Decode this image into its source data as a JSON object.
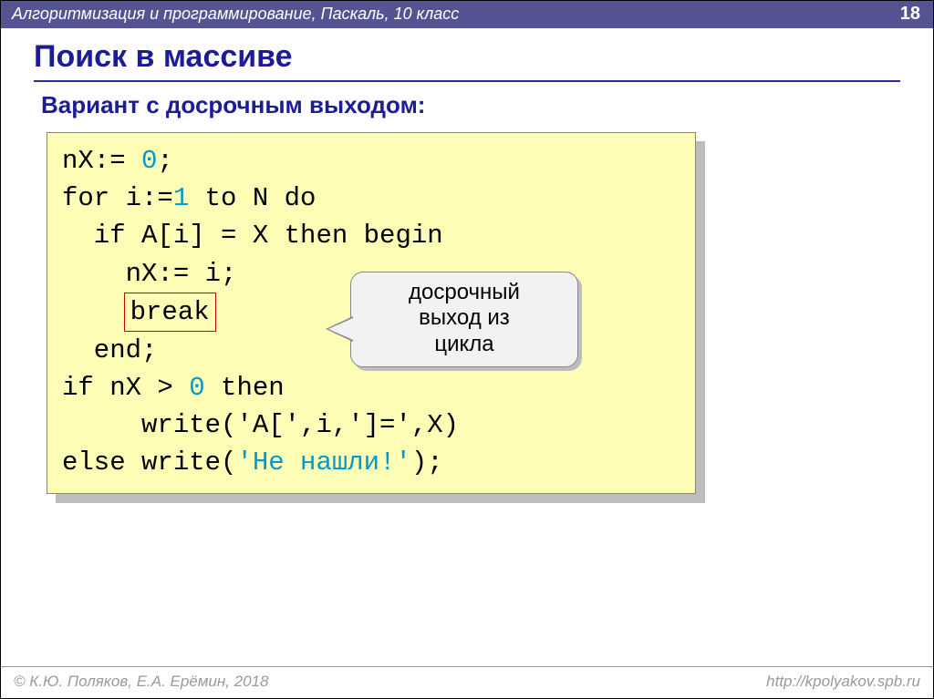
{
  "header": {
    "course": "Алгоритмизация и программирование, Паскаль, 10 класс",
    "page": "18"
  },
  "title": "Поиск в массиве",
  "subtitle": "Вариант с досрочным выходом:",
  "code": {
    "l1a": "nX:= ",
    "l1b": "0",
    "l1c": ";",
    "l2a": "for i:=",
    "l2b": "1",
    "l2c": " to N do",
    "l3": "  if A[i] = X then begin",
    "l4": "    nX:= i;",
    "l5_break": "break",
    "l6": "  end;",
    "l7a": "if nX > ",
    "l7b": "0",
    "l7c": " then",
    "l8": "     write('A[',i,']=',X)",
    "l9a": "else write(",
    "l9b": "'Не нашли!'",
    "l9c": ");"
  },
  "callout": {
    "line1": "досрочный",
    "line2": "выход из",
    "line3": "цикла"
  },
  "footer": {
    "left": "© К.Ю. Поляков, Е.А. Ерёмин, 2018",
    "right": "http://kpolyakov.spb.ru"
  }
}
